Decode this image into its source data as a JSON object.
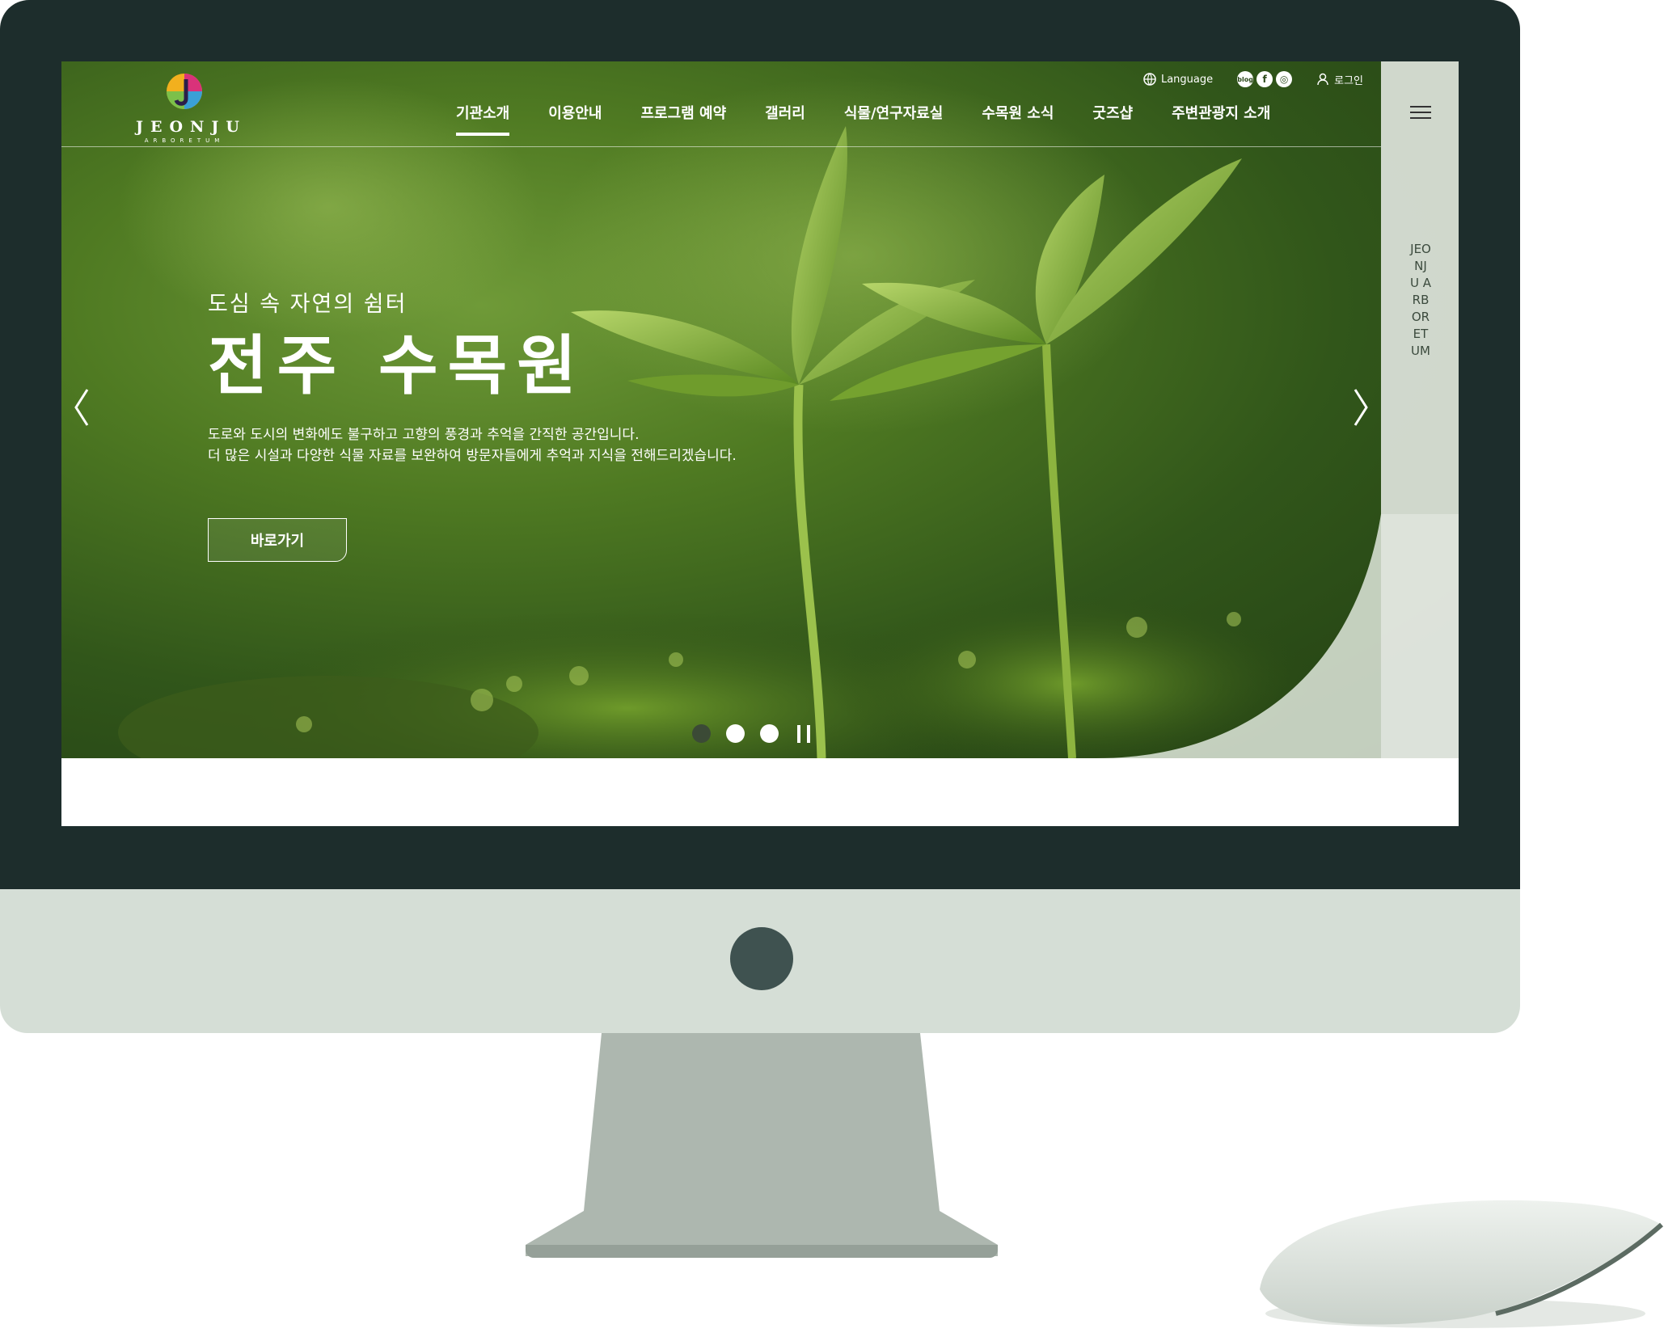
{
  "brand": {
    "logo_text": "JEONJU",
    "logo_sub": "ARBORETUM"
  },
  "utility": {
    "language_label": "Language",
    "sns": [
      "blog",
      "f",
      "◎"
    ],
    "login_label": "로그인"
  },
  "nav": {
    "items": [
      "기관소개",
      "이용안내",
      "프로그램 예약",
      "갤러리",
      "식물/연구자료실",
      "수목원 소식",
      "굿즈샵",
      "주변관광지 소개"
    ],
    "active_index": 0
  },
  "side_panel": {
    "vertical_text": "JEONJU ARBORETUM",
    "menu_icon": "hamburger-icon"
  },
  "hero": {
    "eyebrow": "도심 속 자연의 쉼터",
    "title": "전주 수목원",
    "desc_line1": "도로와 도시의 변화에도 불구하고 고향의 풍경과 추억을 간직한 공간입니다.",
    "desc_line2": "더 많은 시설과 다양한 식물 자료를 보완하여 방문자들에게 추억과 지식을 전해드리겠습니다.",
    "button_label": "바로가기",
    "slides_total": 3,
    "current_slide": 1
  },
  "colors": {
    "bezel": "#1d2d2c",
    "chin": "#d5ded6",
    "stand": "#adb7af",
    "accent_green": "#4f7a22"
  }
}
